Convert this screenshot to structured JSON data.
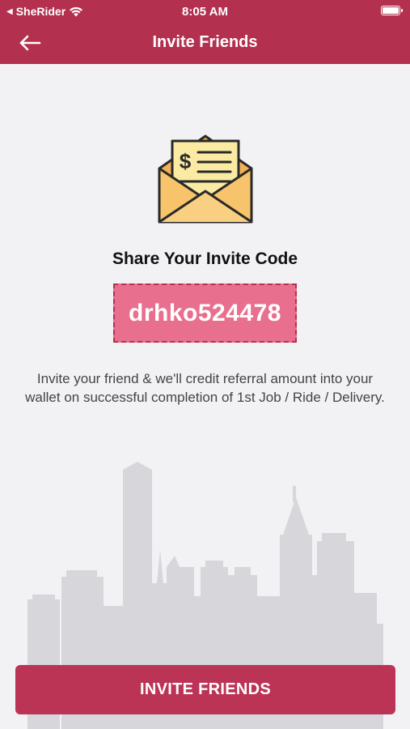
{
  "status_bar": {
    "carrier": "SheRider",
    "time": "8:05 AM"
  },
  "nav": {
    "title": "Invite Friends"
  },
  "content": {
    "heading": "Share Your Invite Code",
    "invite_code": "drhko524478",
    "description": "Invite your friend & we'll credit referral amount into your wallet on successful completion of 1st Job / Ride / Delivery."
  },
  "actions": {
    "invite_button_label": "INVITE FRIENDS"
  },
  "colors": {
    "primary": "#b3304f",
    "code_background": "#e8708e",
    "button": "#bb3456",
    "envelope": "#f4b65c",
    "letter": "#fce9a6"
  }
}
